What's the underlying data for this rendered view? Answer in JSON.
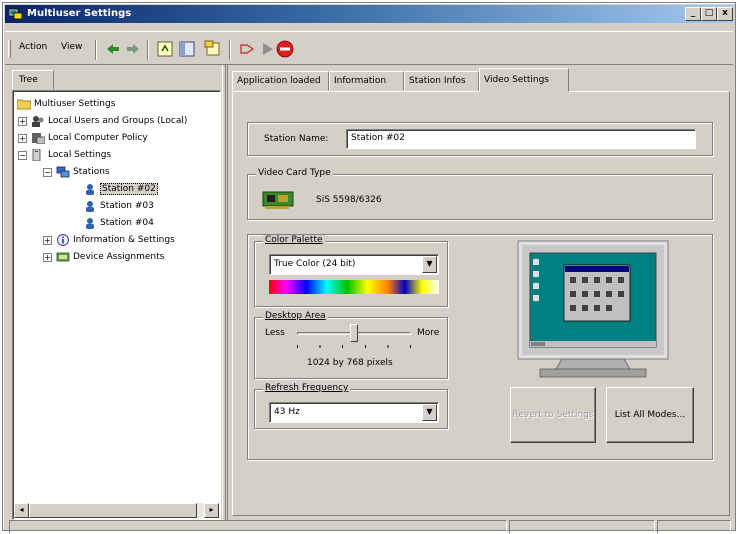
{
  "window": {
    "title": "Multiuser Settings",
    "min_label": "_",
    "max_label": "□",
    "close_label": "x"
  },
  "toolbar": {
    "action_label": "Action",
    "view_label": "View"
  },
  "left_pane": {
    "tab_label": "Tree",
    "tree": [
      {
        "label": "Multiuser Settings"
      },
      {
        "label": "Local Users and Groups (Local)"
      },
      {
        "label": "Local Computer Policy"
      },
      {
        "label": "Local Settings"
      },
      {
        "label": "Stations"
      },
      {
        "label": "Station #02"
      },
      {
        "label": "Station #03"
      },
      {
        "label": "Station #04"
      },
      {
        "label": "Information & Settings"
      },
      {
        "label": "Device Assignments"
      }
    ]
  },
  "tabs": [
    {
      "label": "Application loaded"
    },
    {
      "label": "Information"
    },
    {
      "label": "Station Infos"
    },
    {
      "label": "Video Settings"
    }
  ],
  "video_settings": {
    "station_name_label": "Station Name:",
    "station_name_value": "Station #02",
    "video_card_type_label": "Video Card Type",
    "video_card_type_value": "SiS 5598/6326",
    "color_palette_label": "Color Palette",
    "color_palette_value": "True Color (24 bit)",
    "desktop_area_label": "Desktop Area",
    "desktop_less_label": "Less",
    "desktop_more_label": "More",
    "desktop_area_value": "1024 by 768 pixels",
    "desktop_slider_level": 0.5,
    "refresh_frequency_label": "Refresh Frequency",
    "refresh_frequency_value": "43 Hz",
    "revert_button_label": "Revert to Settings",
    "list_all_modes_label": "List All Modes..."
  },
  "colors": {
    "dialog_bg": "#d4d0c8",
    "title_start": "#0a246a",
    "monitor_desktop": "#008080"
  }
}
